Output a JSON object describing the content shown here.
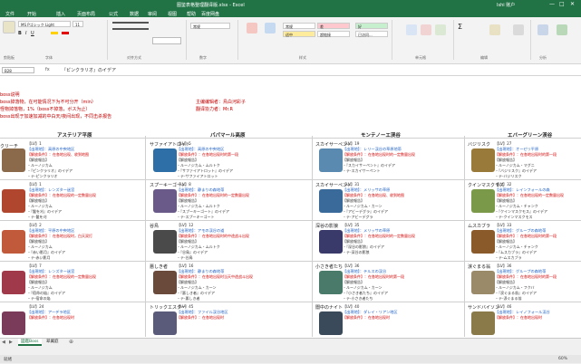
{
  "window": {
    "title": "图鉴表格整理翻译版.xlsx - Excel",
    "user": "Ishi 账户"
  },
  "menu": [
    "文件",
    "开始",
    "插入",
    "页面布局",
    "公式",
    "数据",
    "审阅",
    "视图",
    "帮助",
    "百度网盘"
  ],
  "ribbon": {
    "font_name": "MS Pゴシック Light",
    "font_size": "11",
    "number_format": "常规",
    "styles": [
      {
        "label": "常规",
        "bg": "#ffffff"
      },
      {
        "label": "差",
        "bg": "#ffc7ce"
      },
      {
        "label": "好",
        "bg": "#c6efce"
      },
      {
        "label": "适中",
        "bg": "#ffeb9c"
      },
      {
        "label": "超链接",
        "bg": "#ffffff"
      },
      {
        "label": "已访问...",
        "bg": "#ffffff"
      }
    ],
    "groups": [
      "剪贴板",
      "字体",
      "对齐方式",
      "数字",
      "样式",
      "单元格",
      "编辑",
      "分析"
    ]
  },
  "formula_bar": {
    "name_box": "B28",
    "fx": "fx",
    "content": "『ピンクラリオ』のイデア"
  },
  "notes": [
    "boss说明",
    "boss掉落物，在可能情况下为不可分开（min）",
    "怪物掉落物，1%（boss不掉落，ボス为止）",
    "boss出现于加速加减的中白天/夜间出现，不同击杀报告"
  ],
  "editor": {
    "line1": "主编编辑者：鳥白河彩子",
    "line2": "翻译协力者：Mr.R"
  },
  "columns": [
    "アステリア平原",
    "パパマール高原",
    "モンテノーエ渓谷",
    "エバーグリーン渓谷"
  ],
  "col1_label": "クリーチ",
  "rows": [
    [
      {
        "name": "",
        "lv": "【LV】1",
        "img": "#8a6a4a",
        "lines": [
          "【出現地】：高原の中央地区",
          "【解放条件】：在各地出现、收到地图",
          "【解放報告】",
          "・ルーノジカム",
          "・『ピンクラリオ』のイデア",
          "・テ-ピンクラリオ"
        ]
      },
      {
        "name": "サファイアトロット",
        "lv": "【LV】5",
        "img": "#2e6fa8",
        "lines": [
          "【出現地】：高原の中央地区",
          "【解放条件】：在各地出现时的第一段",
          "【解放報告】",
          "・ルーノジカム・ムルトク",
          "・『サファイアトロット』のイデア",
          "・テ-サファイアトロット"
        ]
      },
      {
        "name": "スカイサーペント",
        "lv": "【LV】19",
        "img": "#5a8ab0",
        "lines": [
          "【出現地】：レリー渓谷の草原地帯",
          "【解放条件】：在各地出现时的一定数量出现",
          "【解放報告】",
          "・『スカイサーペント』のイデア",
          "・テ-スカイサーペント"
        ]
      },
      {
        "name": "バジリスク",
        "lv": "【LV】27",
        "img": "#9a7a3a",
        "lines": [
          "【出現地】：オーゼリ平原",
          "【解放条件】：在各地出现时的第一段",
          "【解放報告】",
          "・ルーノジカム・マグニ",
          "・『バジリスク』のイデア",
          "・テ-バジリスク"
        ]
      }
    ],
    [
      {
        "name": "",
        "lv": "【LV】1",
        "img": "#b0462e",
        "lines": [
          "【出現地】：レンズター迷宮",
          "【解放条件】：在各地出现的一定数量出现",
          "【解放報告】",
          "・ルーノジカム",
          "・『鬣を刈』のイデア",
          "・テ-鬣を刈"
        ]
      },
      {
        "name": "スプーキーゴート",
        "lv": "【LV】8",
        "img": "#6a5a8a",
        "lines": [
          "【出現地】：静まりの森地帯",
          "【解放条件】：在各地出现时的一定数量出现",
          "【解放報告】",
          "・ルーノジカム・ムルトク",
          "・『スプーキーゴート』のイデア",
          "・テ-スプーキーゴート"
        ]
      },
      {
        "name": "スカイサーペント",
        "lv": "【LV】31",
        "img": "#3a6a9a",
        "lines": [
          "【出現地】：メリッサの草原",
          "【解放条件】：在各地出现、收到地图",
          "【解放報告】",
          "・ルーノジカム・カーン",
          "・『アビーデグラ』のイデア",
          "・テ-アビーデグラ"
        ]
      },
      {
        "name": "クインマスクモス",
        "lv": "【LV】32",
        "img": "#7a9a4a",
        "lines": [
          "【出現地】：レインフォールの森",
          "【解放条件】：在各地出现的一定数量出现",
          "【解放報告】",
          "・ルーノジカム・チャンク",
          "・『クインマスクモス』のイデア",
          "・テ-クインマスクモス"
        ]
      }
    ],
    [
      {
        "name": "",
        "lv": "【LV】2",
        "img": "#c05a3a",
        "lines": [
          "【出現地】：平原の中央地区",
          "【解放条件】：在各地出现时，白天双打",
          "【解放報告】",
          "・ルーノジカム",
          "・『赤い影月』のイデア",
          "・テ-赤い影月"
        ]
      },
      {
        "name": "谷鳥",
        "lv": "【LV】12",
        "img": "#4a4a4a",
        "lines": [
          "【出現地】：アモの渓谷の道",
          "【解放条件】：在各地出现时的中途战斗出现",
          "【解放報告】",
          "・ルーノジカム・ムルトク",
          "・『谷鳥』のイデア",
          "・テ-谷鳥"
        ]
      },
      {
        "name": "深谷の影狼",
        "lv": "【LV】35",
        "img": "#3a3a6a",
        "lines": [
          "【出現地】：メリッサの草原",
          "【解放条件】：在各地出现时的一定数量出现",
          "【解放報告】",
          "・『深谷の影狼』のイデア",
          "・テ-深谷の影狼"
        ]
      },
      {
        "name": "ムスカブラ",
        "lv": "【LV】33",
        "img": "#8a5a2a",
        "lines": [
          "【出現地】：グループの森地帯",
          "【解放条件】：在各地出现时的第一段",
          "【解放報告】",
          "・ルーノジカム・チャンク",
          "・『ムスカブラ』のイデア",
          "・テ-ムスカブラ"
        ]
      }
    ],
    [
      {
        "name": "",
        "lv": "【LV】7",
        "img": "#a03a4a",
        "lines": [
          "【出現地】：レンズター迷宮",
          "【解放条件】：在各地出现的一定数量出现",
          "【解放報告】",
          "・ルーノジカム",
          "・『宿命の焔』のイデア",
          "・テ-宿命の焔"
        ]
      },
      {
        "name": "悪しき者",
        "lv": "【LV】16",
        "img": "#6a4a3a",
        "lines": [
          "【出現地】：静まりの森地帯",
          "【解放条件】：在各地出现时当天中途战斗出现",
          "【解放報告】",
          "・ルーノジカム・カーン",
          "・『悪しき者』のイデア",
          "・テ-悪しき者"
        ]
      },
      {
        "name": "小さき者たち",
        "lv": "【LV】36",
        "img": "#4a7a6a",
        "lines": [
          "【出現地】：テルスの渓谷",
          "【解放条件】：在各地出现时的第一段",
          "【解放報告】",
          "・ルーノジカム・カーン",
          "・『小さき者たち』のイデア",
          "・テ-小さき者たち"
        ]
      },
      {
        "name": "涙ぐまる翁",
        "lv": "【LV】36",
        "img": "#9a8a6a",
        "lines": [
          "【出現地】：グループの森地帯",
          "【解放条件】：在各地出现时的第一段",
          "【解放報告】",
          "・ルーノジカム・フクバ",
          "・『涙ぐまる翁』のイデア",
          "・テ-涙ぐまる翁"
        ]
      }
    ],
    [
      {
        "name": "",
        "lv": "【LV】24",
        "img": "#7a3a5a",
        "lines": [
          "【出現地】：アーデラ地区",
          "【解放条件】：在各地出现时"
        ]
      },
      {
        "name": "トリックエスター",
        "lv": "【LV】45",
        "img": "#5a5a7a",
        "lines": [
          "【出現地】：ファイル渓谷地区",
          "【解放条件】：在各地出现时"
        ]
      },
      {
        "name": "闇中のナイト",
        "lv": "【LV】40",
        "img": "#3a4a5a",
        "lines": [
          "【出現地】：ダレイ・リアン地区",
          "【解放条件】：在各地出现时"
        ]
      },
      {
        "name": "サンドバイソン",
        "lv": "【LV】46",
        "img": "#8a7a4a",
        "lines": [
          "【出現地】：レイノフォール渓谷",
          "【解放条件】：在各地出现时"
        ]
      }
    ]
  ],
  "sheets": [
    "図鑑Boss",
    "翠翼庭"
  ],
  "status": {
    "left": "就绪",
    "zoom": "60%"
  }
}
